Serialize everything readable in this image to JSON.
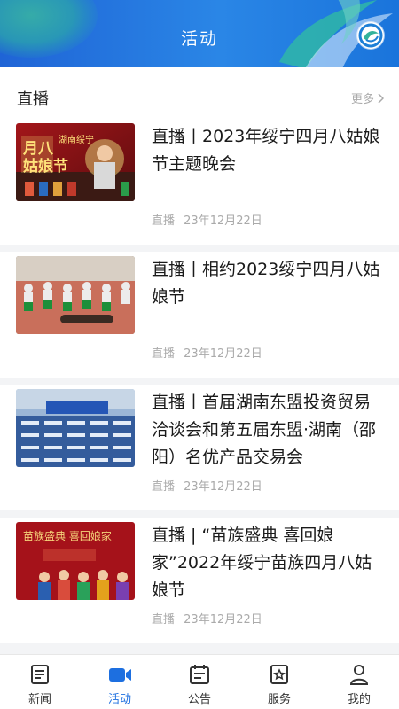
{
  "header": {
    "title": "活动"
  },
  "section": {
    "title": "直播",
    "more_label": "更多"
  },
  "items": [
    {
      "title": "直播丨2023年绥宁四月八姑娘节主题晚会",
      "category": "直播",
      "date": "23年12月22日",
      "thumb_text": "湖南绥宁"
    },
    {
      "title": "直播丨相约2023绥宁四月八姑娘节",
      "category": "直播",
      "date": "23年12月22日"
    },
    {
      "title": "直播丨首届湖南东盟投资贸易洽谈会和第五届东盟·湖南（邵阳）名优产品交易会",
      "category": "直播",
      "date": "23年12月22日"
    },
    {
      "title": "直播 | “苗族盛典 喜回娘家”2022年绥宁苗族四月八姑娘节",
      "category": "直播",
      "date": "23年12月22日",
      "thumb_text": "苗族盛典 喜回娘家"
    }
  ],
  "tabbar": [
    {
      "label": "新闻",
      "icon": "news-icon",
      "active": false
    },
    {
      "label": "活动",
      "icon": "video-camera-icon",
      "active": true
    },
    {
      "label": "公告",
      "icon": "calendar-notice-icon",
      "active": false
    },
    {
      "label": "服务",
      "icon": "service-star-icon",
      "active": false
    },
    {
      "label": "我的",
      "icon": "user-icon",
      "active": false
    }
  ],
  "colors": {
    "accent": "#1d6fe0",
    "header_start": "#1f64d6",
    "header_end": "#2a86e6"
  }
}
